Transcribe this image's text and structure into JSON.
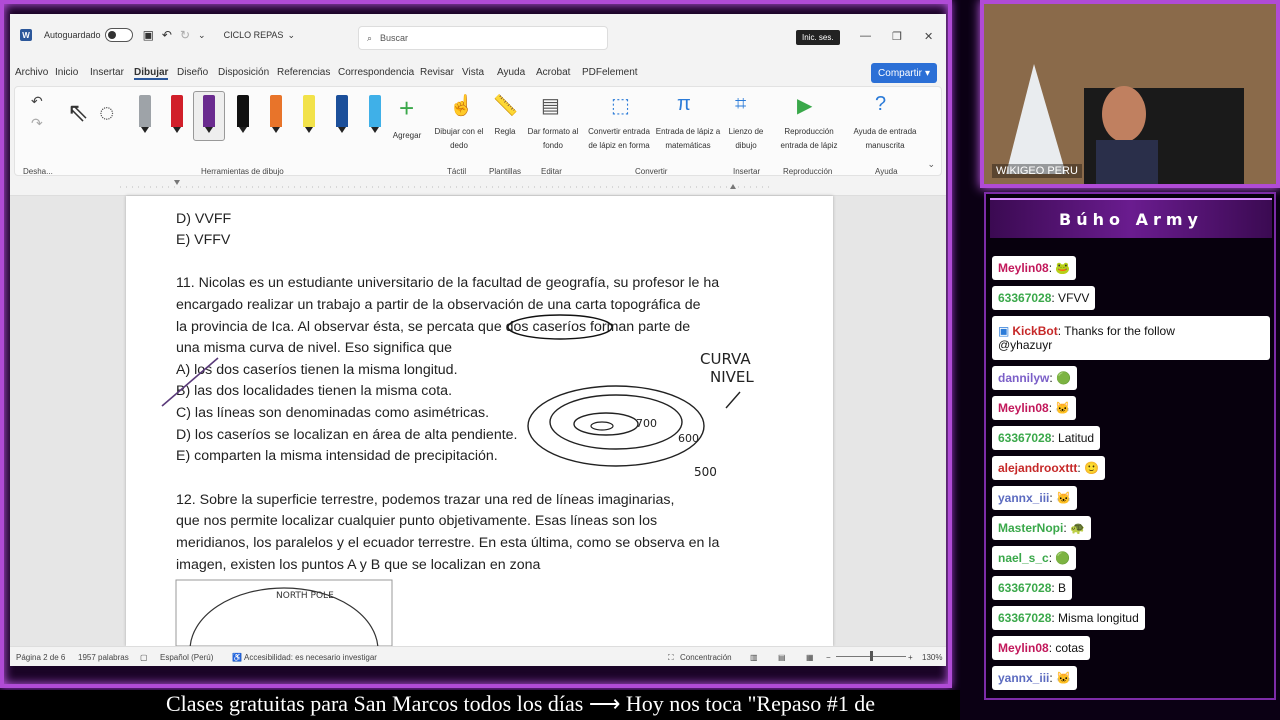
{
  "word": {
    "autosave_label": "Autoguardado",
    "doc_title": "CICLO REPAS",
    "search_placeholder": "Buscar",
    "signin": "Inic. ses.",
    "share_label": "Compartir",
    "menu": [
      "Archivo",
      "Inicio",
      "Insertar",
      "Dibujar",
      "Diseño",
      "Disposición",
      "Referencias",
      "Correspondencia",
      "Revisar",
      "Vista",
      "Ayuda",
      "Acrobat",
      "PDFelement"
    ],
    "ribbon": {
      "undo_group": "Desha...",
      "tools_group": "Herramientas de dibujo",
      "add_label": "Agregar",
      "draw_finger": "Dibujar con el dedo",
      "ruler": "Regla",
      "background": "Dar formato al fondo",
      "convert_shape": "Convertir entrada de lápiz en forma",
      "math": "Entrada de lápiz a matemáticas",
      "canvas": "Lienzo de dibujo",
      "replay": "Reproducción entrada de lápiz",
      "help": "Ayuda de entrada manuscrita",
      "groups": [
        "Táctil",
        "Plantillas",
        "Editar",
        "Convertir",
        "Insertar",
        "Reproducción",
        "Ayuda"
      ]
    },
    "pen_colors": [
      "#9ea3a8",
      "#d11f2a",
      "#6a2b8f",
      "#111111",
      "#e8742a",
      "#f2e24a",
      "#1b4f9a",
      "#3fb0e8"
    ],
    "doc_lines": [
      "D) VVFF",
      "E) VFFV",
      "11. Nicolas es un estudiante universitario de la facultad de geografía, su profesor le ha",
      "encargado realizar un trabajo a partir de la observación de una carta topográfica de",
      "la provincia de Ica. Al observar ésta, se percata que dos caseríos forman parte de",
      "una misma curva de nivel. Eso significa que",
      "A) los dos caseríos tienen la misma longitud.",
      "B) las dos localidades tienen la misma cota.",
      "C) las líneas son denominadas como asimétricas.",
      "D) los caseríos se localizan en área de alta pendiente.",
      "E) comparten la misma intensidad de precipitación.",
      "12. Sobre la superficie terrestre, podemos trazar una red de líneas imaginarias,",
      "que nos permite localizar cualquier punto objetivamente. Esas líneas son los",
      "meridianos, los paralelos y el ecuador terrestre. En esta última, como se observa en la",
      "imagen, existen los puntos A y B que se localizan en zona"
    ],
    "sketch_labels": {
      "curva": "CURVA",
      "nivel": "NIVEL",
      "v700": "700",
      "v600": "600",
      "v500": "500",
      "pole": "NORTH POLE"
    },
    "status": {
      "page": "Página 2 de 6",
      "words": "1957 palabras",
      "lang": "Español (Perú)",
      "access": "Accesibilidad: es necesario investigar",
      "focus": "Concentración",
      "zoom": "130%"
    }
  },
  "camera_label": "WIKIGEO PERU",
  "chat": {
    "title": "Búho Army",
    "messages": [
      {
        "user": "Meylin08",
        "color": "#c2185b",
        "text": ": 🐸"
      },
      {
        "user": "63367028",
        "color": "#3aa84a",
        "text": ": VFVV"
      },
      {
        "user": "KickBot",
        "color": "#c62828",
        "text": ": Thanks for the follow"
      },
      {
        "user": "@yhazuyr",
        "color": "#111111",
        "text": ""
      },
      {
        "user": "dannilyw",
        "color": "#7b5fc8",
        "text": ": 🟢"
      },
      {
        "user": "Meylin08",
        "color": "#c2185b",
        "text": ": 🐱"
      },
      {
        "user": "63367028",
        "color": "#3aa84a",
        "text": ": Latitud"
      },
      {
        "user": "alejandrooxttt",
        "color": "#c62828",
        "text": ": 🙂"
      },
      {
        "user": "yannx_iii",
        "color": "#5c6bc0",
        "text": ": 🐱"
      },
      {
        "user": "MasterNopi",
        "color": "#3aa84a",
        "text": ": 🐢"
      },
      {
        "user": "nael_s_c",
        "color": "#3aa84a",
        "text": ": 🟢"
      },
      {
        "user": "63367028",
        "color": "#3aa84a",
        "text": ": B"
      },
      {
        "user": "63367028",
        "color": "#3aa84a",
        "text": ": Misma longitud"
      },
      {
        "user": "Meylin08",
        "color": "#c2185b",
        "text": ": cotas"
      },
      {
        "user": "yannx_iii",
        "color": "#5c6bc0",
        "text": ": 🐱"
      }
    ]
  },
  "ticker": "Clases gratuitas para San Marcos todos los días  ⟶  Hoy nos toca \"Repaso #1 de"
}
